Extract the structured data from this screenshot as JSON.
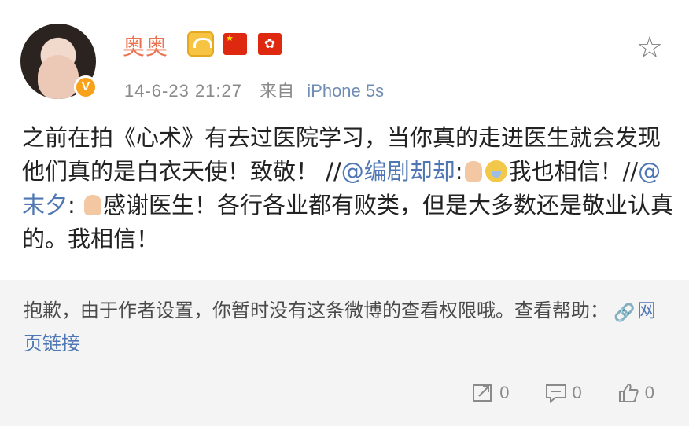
{
  "post": {
    "username": "奥奥",
    "time": "14-6-23 21:27",
    "source_prefix": "来自",
    "device": "iPhone 5s",
    "text_part1": "之前在拍《心术》有去过医院学习，当你真的走进医生就会发现他们真的是白衣天使！致敬！ //",
    "mention1": "@编剧却却",
    "text_part2": ":",
    "text_part3": "我也相信！//",
    "mention2": "@末夕",
    "text_part4": ": ",
    "text_part5": "感谢医生！各行各业都有败类，但是大多数还是敬业认真的。我相信！"
  },
  "notice": {
    "text": "抱歉，由于作者设置，你暂时没有这条微博的查看权限哦。查看帮助：",
    "link_label": "网页链接"
  },
  "actions": {
    "repost_count": "0",
    "comment_count": "0",
    "like_count": "0"
  },
  "icons": {
    "favorite": "star-icon",
    "verified": "verified-badge-icon",
    "crown": "crown-icon",
    "flag1": "china-flag-icon",
    "flag2": "hong-kong-flag-icon",
    "repost": "repost-icon",
    "comment": "comment-icon",
    "like": "thumbs-up-icon",
    "link": "link-icon"
  },
  "colors": {
    "username": "#eb7350",
    "mention": "#4e77b3",
    "notice_bg": "#f4f4f4"
  }
}
